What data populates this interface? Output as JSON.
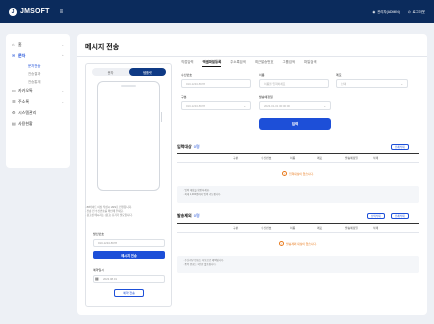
{
  "header": {
    "logo_mark": "J",
    "logo_text": "JMSOFT",
    "menu_icon": "hamburger-icon",
    "user_label": "관리자(ADMIN)",
    "logout_label": "로그아웃"
  },
  "sidebar": {
    "items": [
      {
        "icon": "home-icon",
        "label": "홈",
        "chev": "⌄"
      },
      {
        "icon": "send-icon",
        "label": "문자",
        "chev": "⌃",
        "active": true
      },
      {
        "icon": "card-icon",
        "label": "카카오톡",
        "chev": "⌄"
      },
      {
        "icon": "book-icon",
        "label": "주소록",
        "chev": "⌄"
      },
      {
        "icon": "gear-icon",
        "label": "시스템관리"
      },
      {
        "icon": "chart-icon",
        "label": "사용현황"
      }
    ],
    "subitems": [
      "문자전송",
      "전송결과",
      "전송통계"
    ]
  },
  "main": {
    "title": "메시지 전송",
    "segment": [
      "문자",
      "템플릿"
    ],
    "notes": [
      "· 80바이트 이상 작성시 LMS로 전환됩니다.",
      "· 전송 전 수신번호를 확인해 주세요.",
      "· 광고성 메시지는 (광고) 표기가 필요합니다."
    ],
    "sender_label": "발신번호",
    "sender_placeholder": "010-1234-5678",
    "send_button": "메시지 전송",
    "reserve_label": "예약일시",
    "reserve_value": "2023.08.01",
    "reserve_button": "예약 전송"
  },
  "tabs": [
    "직접입력",
    "엑셀파일등록",
    "주소록검색",
    "최근발송번호",
    "그룹검색",
    "파일검색"
  ],
  "form": {
    "fields": [
      {
        "label": "수신번호",
        "placeholder": "010-1234-5678"
      },
      {
        "label": "이름",
        "placeholder": "이름을 입력하세요"
      },
      {
        "label": "메모",
        "placeholder": "선택"
      },
      {
        "label": "구분",
        "placeholder": "010-1234-5678"
      },
      {
        "label": "발송예정일",
        "placeholder": "2023-01-01 00:00:00"
      }
    ],
    "search_button": "입력"
  },
  "recipients": {
    "title": "입력대상",
    "count": "0명",
    "button": "전체삭제",
    "columns": [
      "구분",
      "수신번호",
      "이름",
      "메모",
      "발송예정일",
      "삭제"
    ],
    "empty": "입력대상이 없습니다.",
    "notes": [
      "· 입력 대상을 확인하세요.",
      "· 최대 1,000명까지 입력 가능합니다."
    ]
  },
  "exceptions": {
    "title": "발송제외",
    "count": "0명",
    "buttons": [
      "선택삭제",
      "전체삭제"
    ],
    "columns": [
      "구분",
      "수신번호",
      "이름",
      "메모",
      "발송예정일",
      "삭제"
    ],
    "empty": "발송제외 대상이 없습니다.",
    "notes": [
      "· 수신거부 번호는 자동으로 제외됩니다.",
      "· 중복 번호는 1건만 발송됩니다."
    ]
  }
}
